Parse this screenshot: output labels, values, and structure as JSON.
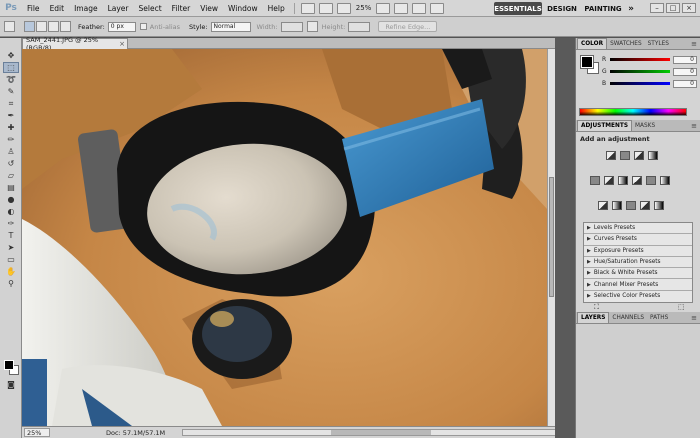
{
  "menubar": {
    "logo": "Ps",
    "items": [
      "File",
      "Edit",
      "Image",
      "Layer",
      "Select",
      "Filter",
      "View",
      "Window",
      "Help"
    ],
    "zoom": "25%",
    "workspaces": {
      "essentials": "ESSENTIALS",
      "design": "DESIGN",
      "painting": "PAINTING",
      "more": "»"
    },
    "window_controls": {
      "minimize": "–",
      "restore": "□",
      "close": "×"
    }
  },
  "options": {
    "feather_label": "Feather:",
    "feather_value": "0 px",
    "antialias_label": "Anti-alias",
    "style_label": "Style:",
    "style_value": "Normal",
    "width_label": "Width:",
    "height_label": "Height:",
    "refine_label": "Refine Edge..."
  },
  "document": {
    "tab_title": "SAM_2441.JPG @ 25% (RGB/8)",
    "tab_close": "×",
    "status_zoom": "25%",
    "status_doc": "Doc: 57.1M/57.1M"
  },
  "color_panel": {
    "tabs": [
      "COLOR",
      "SWATCHES",
      "STYLES"
    ],
    "sliders": [
      {
        "label": "R",
        "value": "0",
        "gradient": "linear-gradient(to right,#000,#f00)"
      },
      {
        "label": "G",
        "value": "0",
        "gradient": "linear-gradient(to right,#000,#0c0)"
      },
      {
        "label": "B",
        "value": "0",
        "gradient": "linear-gradient(to right,#000,#00f)"
      }
    ]
  },
  "adjustments": {
    "tabs": [
      "ADJUSTMENTS",
      "MASKS"
    ],
    "title": "Add an adjustment",
    "presets": [
      "Levels Presets",
      "Curves Presets",
      "Exposure Presets",
      "Hue/Saturation Presets",
      "Black & White Presets",
      "Channel Mixer Presets",
      "Selective Color Presets"
    ]
  },
  "layers": {
    "tabs": [
      "LAYERS",
      "CHANNELS",
      "PATHS"
    ]
  }
}
